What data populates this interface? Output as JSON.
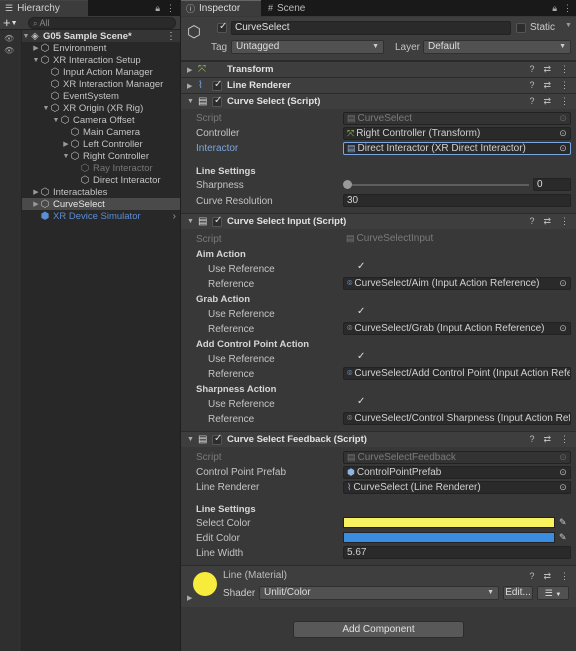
{
  "hierarchy": {
    "tab_label": "Hierarchy",
    "search_placeholder": "All",
    "rows": [
      {
        "label": "G05 Sample Scene*"
      },
      {
        "label": "Environment"
      },
      {
        "label": "XR Interaction Setup"
      },
      {
        "label": "Input Action Manager"
      },
      {
        "label": "XR Interaction Manager"
      },
      {
        "label": "EventSystem"
      },
      {
        "label": "XR Origin (XR Rig)"
      },
      {
        "label": "Camera Offset"
      },
      {
        "label": "Main Camera"
      },
      {
        "label": "Left Controller"
      },
      {
        "label": "Right Controller"
      },
      {
        "label": "Ray Interactor"
      },
      {
        "label": "Direct Interactor"
      },
      {
        "label": "Interactables"
      },
      {
        "label": "CurveSelect"
      },
      {
        "label": "XR Device Simulator"
      }
    ]
  },
  "inspector": {
    "tab_label": "Inspector",
    "scene_tab_label": "Scene",
    "object_name": "CurveSelect",
    "static_label": "Static",
    "tag_label": "Tag",
    "tag_value": "Untagged",
    "layer_label": "Layer",
    "layer_value": "Default",
    "components": {
      "transform": {
        "title": "Transform"
      },
      "line_renderer": {
        "title": "Line Renderer"
      },
      "curve_select": {
        "title": "Curve Select (Script)",
        "script_label": "Script",
        "script_value": "CurveSelect",
        "controller_label": "Controller",
        "controller_value": "Right Controller (Transform)",
        "interactor_label": "Interactor",
        "interactor_value": "Direct Interactor (XR Direct Interactor)",
        "line_settings_label": "Line Settings",
        "sharpness_label": "Sharpness",
        "sharpness_value": "0",
        "curve_resolution_label": "Curve Resolution",
        "curve_resolution_value": "30"
      },
      "curve_select_input": {
        "title": "Curve Select Input (Script)",
        "script_label": "Script",
        "script_value": "CurveSelectInput",
        "aim_action_label": "Aim Action",
        "use_reference_label": "Use Reference",
        "reference_label": "Reference",
        "aim_reference_value": "CurveSelect/Aim (Input Action Reference)",
        "grab_action_label": "Grab Action",
        "grab_reference_value": "CurveSelect/Grab (Input Action Reference)",
        "add_cp_action_label": "Add Control Point Action",
        "add_cp_reference_value": "CurveSelect/Add Control Point (Input Action Reference)",
        "sharpness_action_label": "Sharpness Action",
        "sharpness_reference_value": "CurveSelect/Control Sharpness (Input Action Reference)"
      },
      "curve_select_feedback": {
        "title": "Curve Select Feedback (Script)",
        "script_label": "Script",
        "script_value": "CurveSelectFeedback",
        "control_point_prefab_label": "Control Point Prefab",
        "control_point_prefab_value": "ControlPointPrefab",
        "line_renderer_label": "Line Renderer",
        "line_renderer_value": "CurveSelect (Line Renderer)",
        "line_settings_label": "Line Settings",
        "select_color_label": "Select Color",
        "select_color": "#f8f261",
        "edit_color_label": "Edit Color",
        "edit_color": "#3a8de0",
        "line_width_label": "Line Width",
        "line_width_value": "5.67"
      }
    },
    "material": {
      "name": "Line (Material)",
      "color": "#f7ec3c",
      "shader_label": "Shader",
      "shader_value": "Unlit/Color",
      "edit_button": "Edit..."
    },
    "add_component_label": "Add Component"
  }
}
